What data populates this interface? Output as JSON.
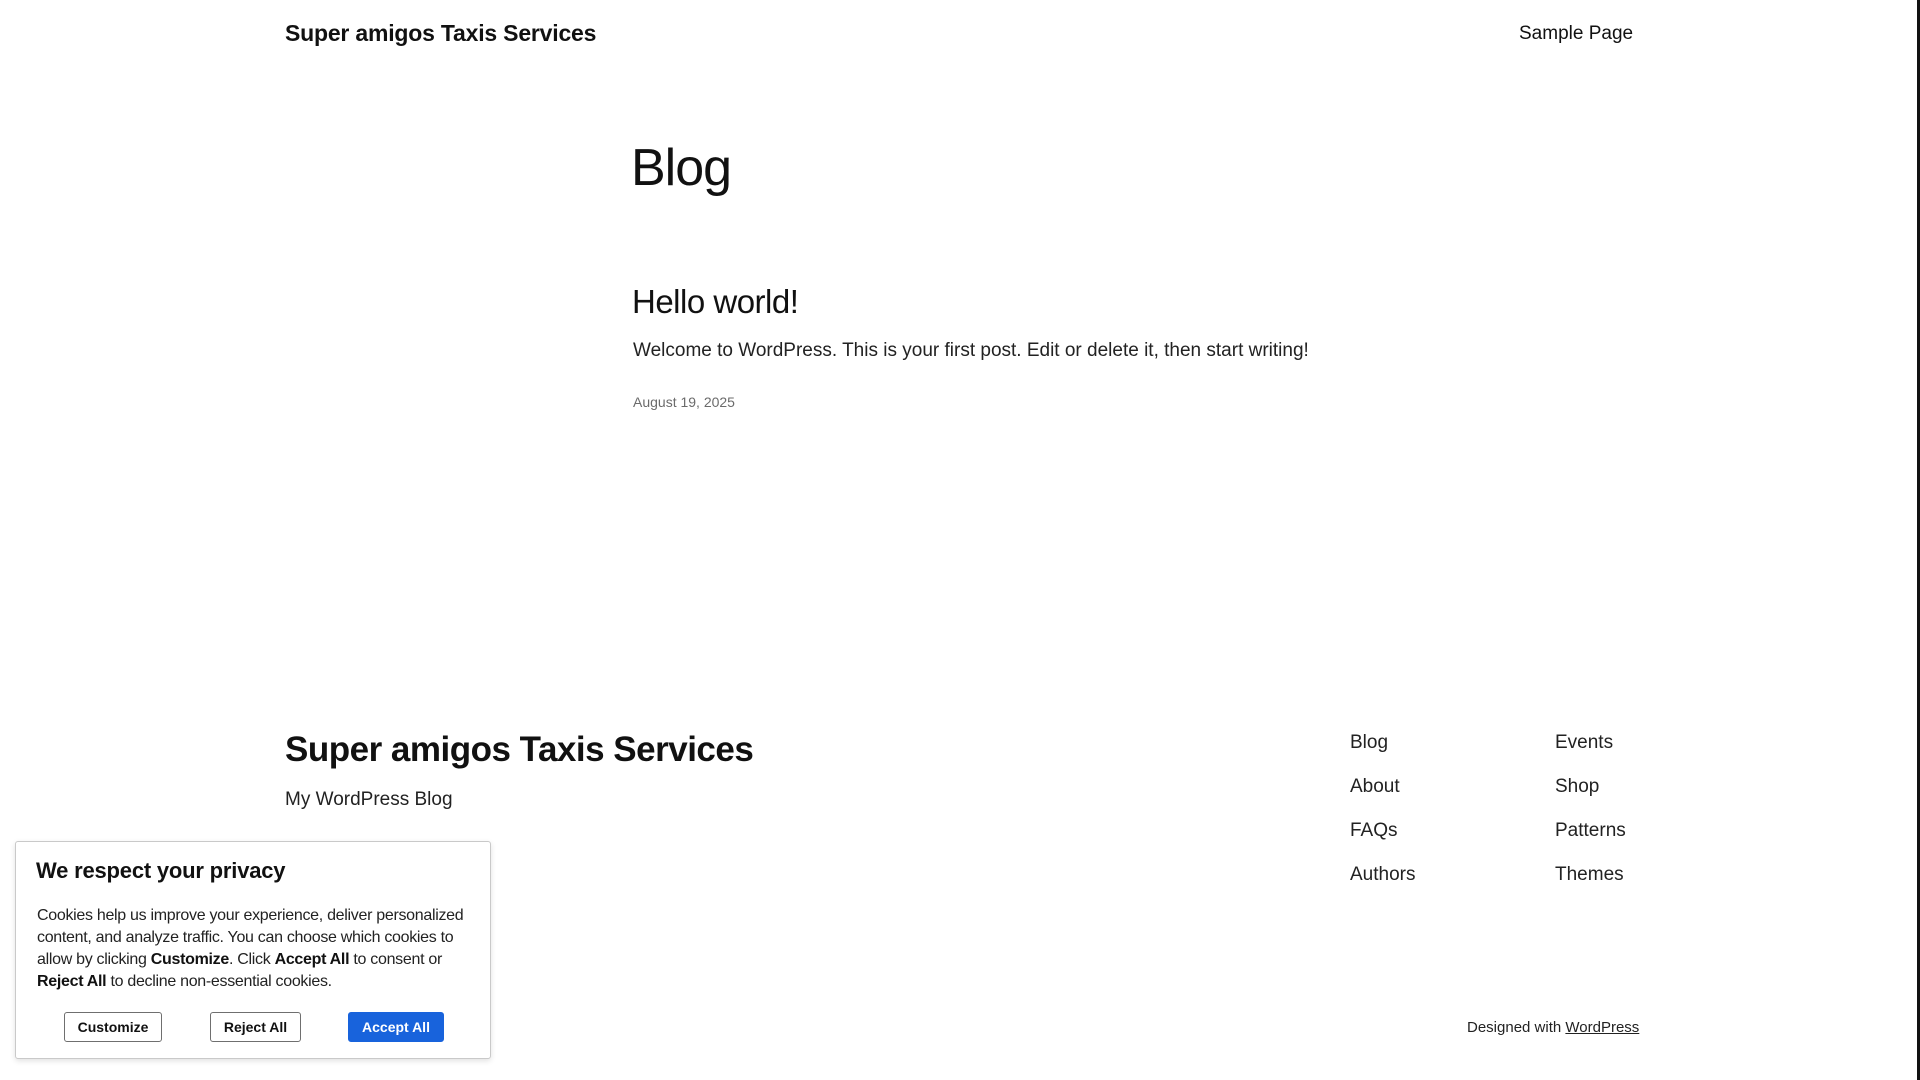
{
  "header": {
    "site_title": "Super amigos Taxis Services",
    "nav": [
      "Sample Page"
    ]
  },
  "main": {
    "heading": "Blog",
    "post": {
      "title": "Hello world!",
      "excerpt": "Welcome to WordPress. This is your first post. Edit or delete it, then start writing!",
      "date": "August 19, 2025"
    }
  },
  "footer": {
    "site_title": "Super amigos Taxis Services",
    "tagline": "My WordPress Blog",
    "links_col1": [
      "Blog",
      "About",
      "FAQs",
      "Authors"
    ],
    "links_col2": [
      "Events",
      "Shop",
      "Patterns",
      "Themes"
    ],
    "credit_prefix": "Designed with",
    "credit_link": "WordPress"
  },
  "cookie_banner": {
    "title": "We respect your privacy",
    "text_1": "Cookies help us improve your experience, deliver personalized content, and analyze traffic. You can choose which cookies to allow by clicking ",
    "bold_customize": "Customize",
    "text_2": ". Click ",
    "bold_accept": "Accept All",
    "text_3": " to consent or ",
    "bold_reject": "Reject All",
    "text_4": " to decline non-essential cookies.",
    "buttons": {
      "customize": "Customize",
      "reject": "Reject All",
      "accept": "Accept All"
    },
    "accept_color": "#1863dc"
  }
}
